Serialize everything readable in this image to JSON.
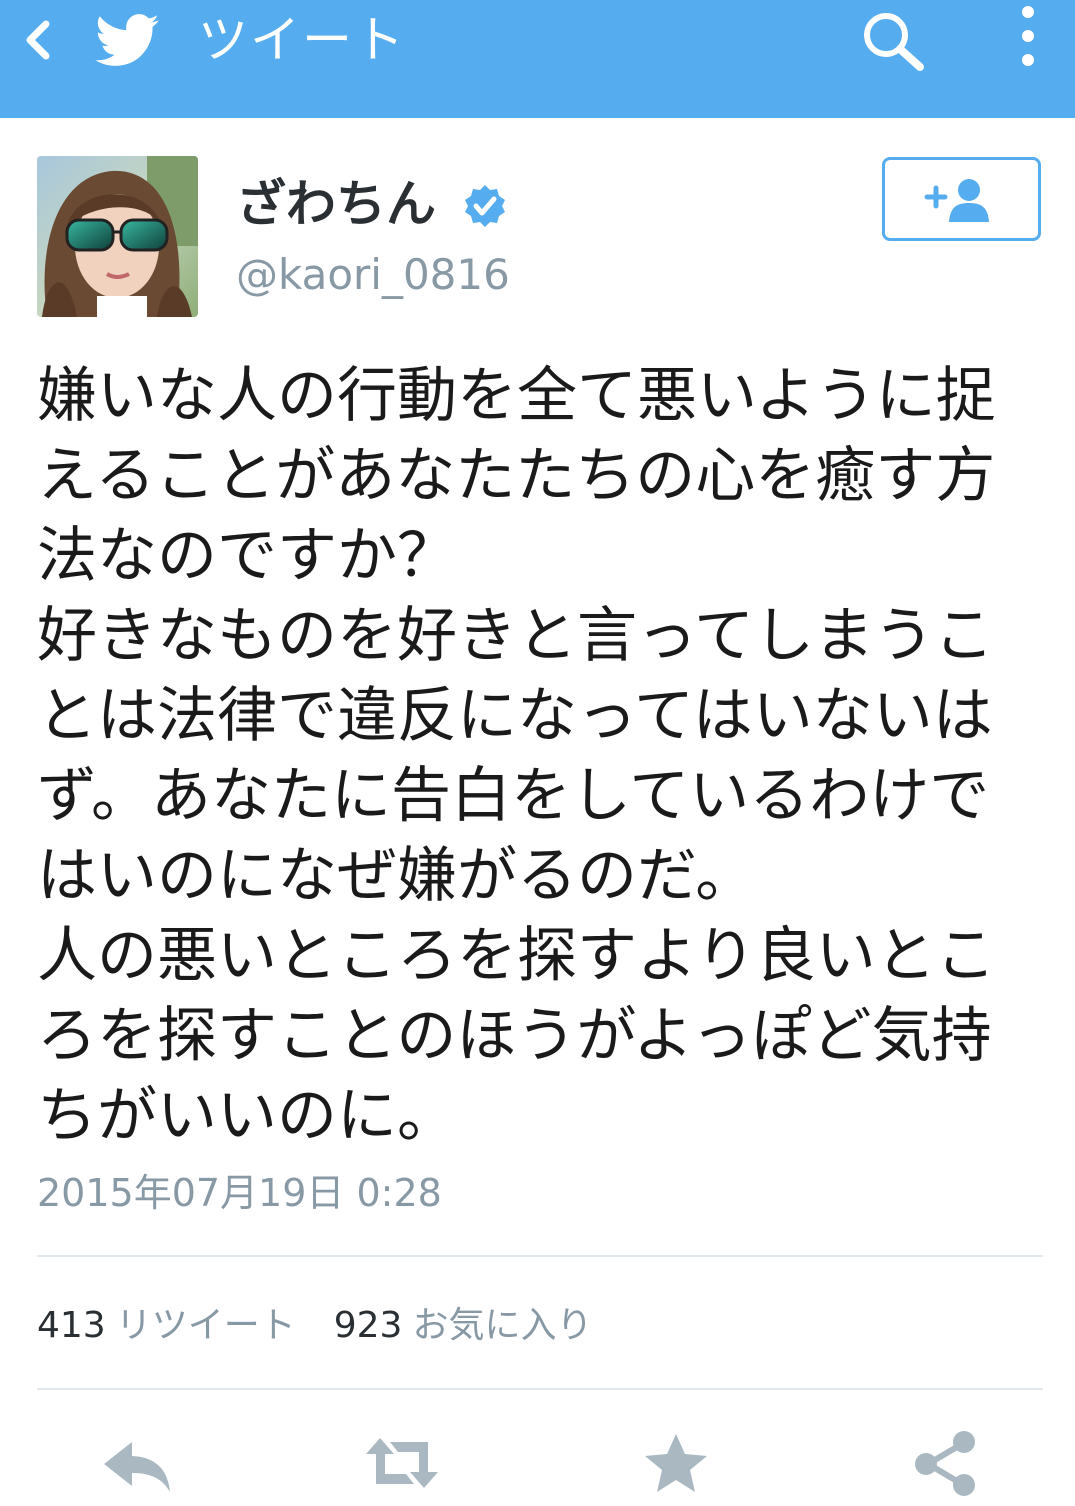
{
  "header": {
    "title": "ツイート",
    "back_icon": "chevron-left-icon",
    "logo_icon": "twitter-bird-icon",
    "search_icon": "search-icon",
    "menu_icon": "more-vertical-icon",
    "background_color": "#55acee"
  },
  "user": {
    "display_name": "ざわちん",
    "handle": "@kaori_0816",
    "verified": true,
    "verified_icon": "verified-badge-icon",
    "follow_button_icon": "add-user-icon"
  },
  "tweet": {
    "text": "嫌いな人の行動を全て悪いように捉\nえることがあなたたちの心を癒す方\n法なのですか？\n好きなものを好きと言ってしまうこ\nとは法律で違反になってはいないは\nず。あなたに告白をしているわけで\nはいのになぜ嫌がるのだ。\n人の悪いところを探すより良いとこ\nろを探すことのほうがよっぽど気持\nちがいいのに。",
    "timestamp": "2015年07月19日 0:28"
  },
  "stats": {
    "retweets_count": "413",
    "retweets_label": "リツイート",
    "favorites_count": "923",
    "favorites_label": "お気に入り"
  },
  "actions": {
    "reply_icon": "reply-icon",
    "retweet_icon": "retweet-icon",
    "favorite_icon": "star-icon",
    "share_icon": "share-icon",
    "icon_color": "#aab8c2"
  }
}
